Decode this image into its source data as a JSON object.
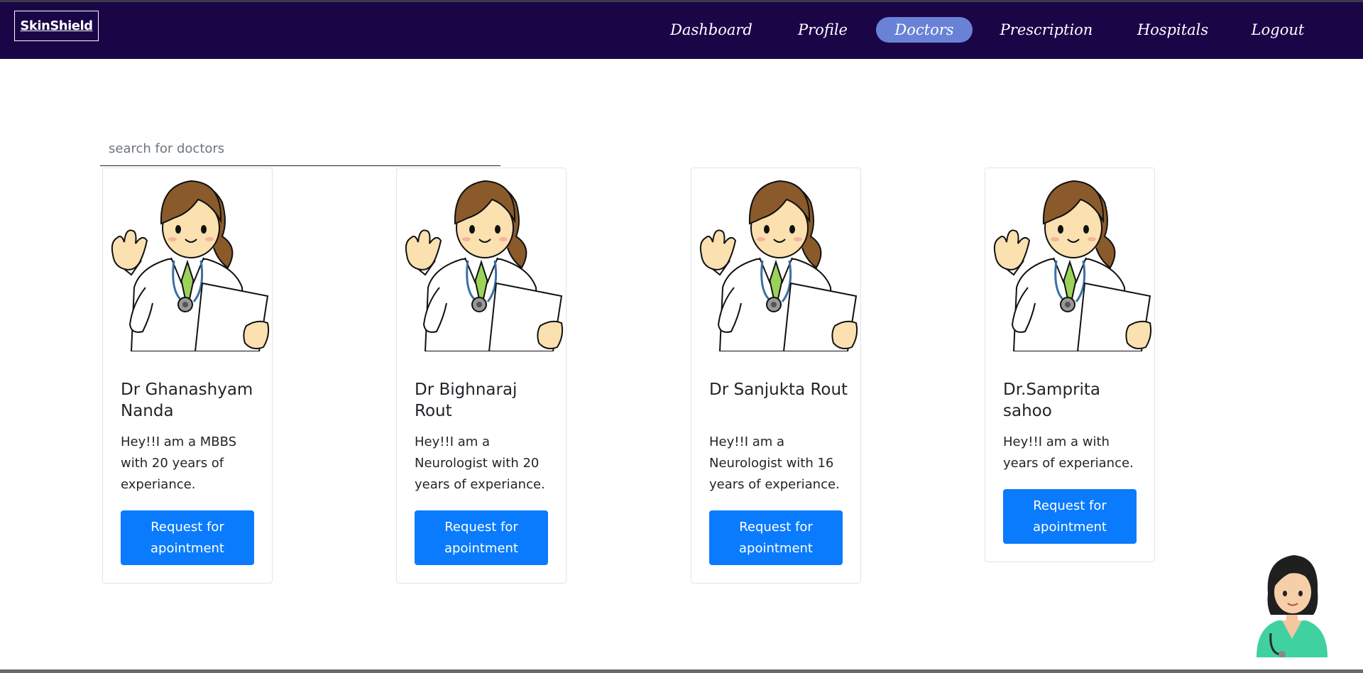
{
  "app": {
    "brand": "SkinShield"
  },
  "nav": {
    "items": [
      {
        "label": "Dashboard",
        "active": false
      },
      {
        "label": "Profile",
        "active": false
      },
      {
        "label": "Doctors",
        "active": true
      },
      {
        "label": "Prescription",
        "active": false
      },
      {
        "label": "Hospitals",
        "active": false
      },
      {
        "label": "Logout",
        "active": false
      }
    ]
  },
  "search": {
    "placeholder": "search for doctors",
    "value": ""
  },
  "doctors": [
    {
      "name": "Dr Ghanashyam Nanda",
      "bio": "Hey!!I am a MBBS with 20 years of experiance.",
      "button": "Request for apointment"
    },
    {
      "name": "Dr Bighnaraj Rout",
      "bio": "Hey!!I am a Neurologist with 20 years of experiance.",
      "button": "Request for apointment"
    },
    {
      "name": "Dr Sanjukta Rout",
      "bio": "Hey!!I am a Neurologist with 16 years of experiance.",
      "button": "Request for apointment"
    },
    {
      "name": "Dr.Samprita sahoo",
      "bio": "Hey!!I am a with years of experiance.",
      "button": "Request for apointment"
    }
  ],
  "icons": {
    "doctor_avatar": "female-doctor-cartoon-icon",
    "assistant": "chat-assistant-nurse-icon"
  },
  "colors": {
    "navbar": "#1a0547",
    "active_pill": "#6a82d6",
    "button": "#0a7bfc"
  }
}
